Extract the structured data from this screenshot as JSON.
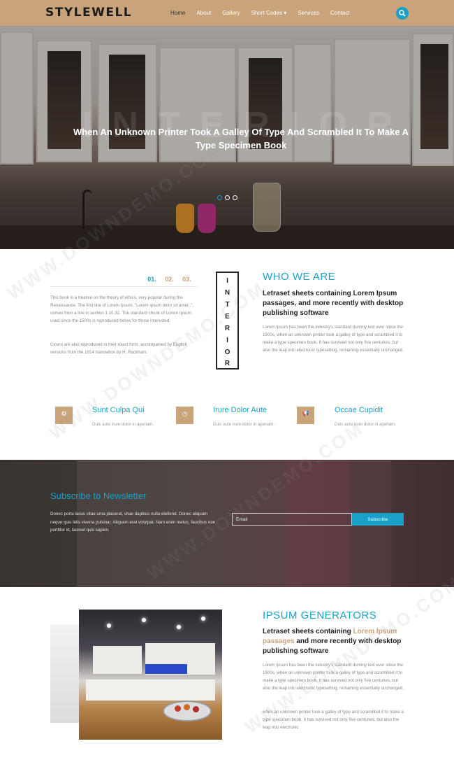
{
  "header": {
    "logo": "STYLEWELL",
    "nav": [
      {
        "label": "Home",
        "active": true
      },
      {
        "label": "About",
        "active": false
      },
      {
        "label": "Gallery",
        "active": false
      },
      {
        "label": "Short Codes ▾",
        "active": false
      },
      {
        "label": "Services",
        "active": false
      },
      {
        "label": "Contact",
        "active": false
      }
    ],
    "search_icon": "search-icon"
  },
  "hero": {
    "bg_word": "INTERIOR",
    "title": "When An Unknown Printer Took A Galley Of Type And Scrambled It To Make A Type Specimen Book",
    "slides": 3,
    "active_slide": 1
  },
  "about": {
    "tabs": [
      "01.",
      "02.",
      "03."
    ],
    "para1": "This book is a treatise on the theory of ethics, very popular during the Renaissance. The first line of Lorem Ipsum, \"Lorem ipsum dolor sit amet..\", comes from a line in section 1.10.32. The standard chunk of Lorem Ipsum used since the 1500s is reproduced below for those interested.",
    "para2": "Cicero are also reproduced in their exact form, accompanied by English versions from the 1914 translation by H. Rackham.",
    "vertical_word": [
      "I",
      "N",
      "T",
      "E",
      "R",
      "I",
      "O",
      "R"
    ],
    "heading": "WHO WE ARE",
    "subheading": "Letraset sheets containing Lorem Ipsum passages, and more recently with desktop publishing software",
    "body": "Lorem Ipsum has been the industry's standard dummy text ever since the 1500s, when an unknown printer took a galley of type and scrambled it to make a type specimen book. It has survived not only five centuries, but also the leap into electronic typesetting, remaining essentially unchanged."
  },
  "features": [
    {
      "icon": "gear-icon",
      "glyph": "⚙",
      "title": "Sunt Culpa Qui",
      "text": "Duis aute irure dolor in aperiam."
    },
    {
      "icon": "clock-icon",
      "glyph": "◷",
      "title": "Irure Dolor Aute",
      "text": "Duis aute irure dolor in aperiam."
    },
    {
      "icon": "megaphone-icon",
      "glyph": "📢",
      "title": "Occae Cupidit",
      "text": "Duis aute irure dolor in aperiam."
    }
  ],
  "newsletter": {
    "title": "Subscribe to Newsletter",
    "text": "Donec porta lacus vitae urna placerat, vitae dapibus nulla eleifend. Donec aliquam neque quis felis viverra pulvinar. Aliquam erat volutpat. Nam enim metus, faucibus non porttitor id, laoreet quis sapien.",
    "email_placeholder": "Email",
    "button": "Subscribe"
  },
  "generators": {
    "heading": "IPSUM GENERATORS",
    "sub_pre": "Letraset sheets containing ",
    "sub_accent": "Lorem Ipsum passages",
    "sub_post": " and more recently with desktop publishing software",
    "body1": "Lorem Ipsum has been the industry's standard dummy text ever since the 1500s, when an unknown printer took a galley of type and scrambled it to make a type specimen book. It has survived not only five centuries, but also the leap into electronic typesetting, remaining essentially unchanged.",
    "body2": "when an unknown printer took a galley of type and scrambled it to make a type specimen book. It has survived not only five centuries, but also the leap into electronic"
  },
  "watermark": "WWW.DOWNDEMO.COM",
  "colors": {
    "accent": "#1ba0c8",
    "tan": "#c9a37a"
  }
}
